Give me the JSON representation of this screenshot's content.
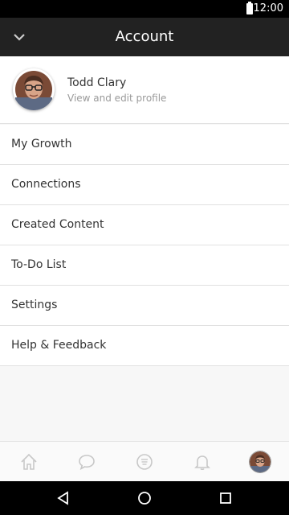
{
  "status_bar": {
    "time": "12:00"
  },
  "app_bar": {
    "title": "Account",
    "collapse_icon": "chevron-down-icon"
  },
  "profile": {
    "name": "Todd Clary",
    "subtitle": "View and edit profile"
  },
  "menu": [
    {
      "label": "My Growth"
    },
    {
      "label": "Connections"
    },
    {
      "label": "Created Content"
    },
    {
      "label": "To-Do List"
    },
    {
      "label": "Settings"
    },
    {
      "label": "Help & Feedback"
    }
  ],
  "tab_bar": {
    "tabs": [
      {
        "icon": "home-icon"
      },
      {
        "icon": "chat-icon"
      },
      {
        "icon": "feed-icon"
      },
      {
        "icon": "bell-icon"
      },
      {
        "icon": "profile-avatar",
        "selected": true
      }
    ]
  },
  "nav_bar": {
    "buttons": [
      "back-icon",
      "home-circle-icon",
      "recents-icon"
    ]
  },
  "colors": {
    "app_bar": "#222222",
    "divider": "#e1e1e1",
    "text": "#333333",
    "muted": "#9a9a9a",
    "tab_icon": "#c8c8c8"
  }
}
